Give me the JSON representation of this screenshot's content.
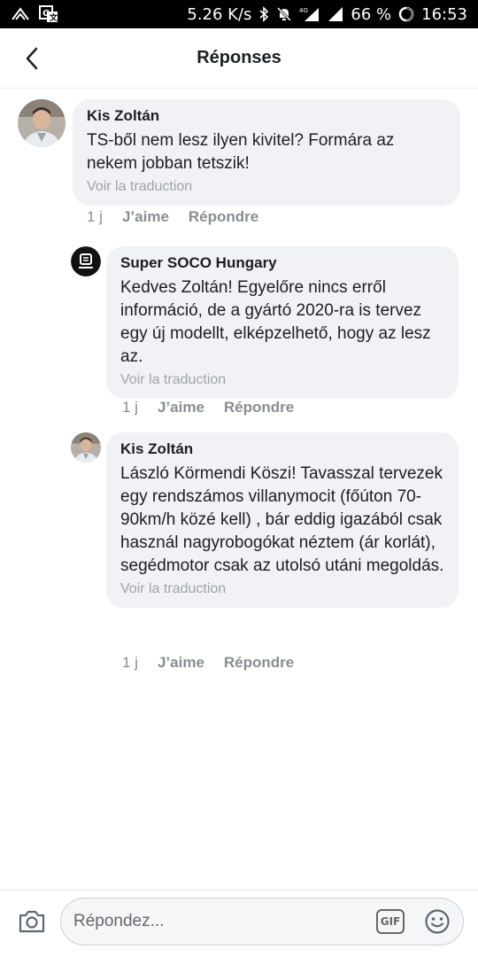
{
  "status_bar": {
    "speed": "5.26 K/s",
    "network": "4G",
    "battery": "66 %",
    "time": "16:53"
  },
  "header": {
    "title": "Réponses"
  },
  "comments": [
    {
      "author": "Kis Zoltán",
      "text": "TS-ből nem lesz ilyen kivitel? Formára az nekem jobban tetszik!",
      "translate": "Voir la traduction",
      "time": "1 j",
      "like": "J’aime",
      "reply": "Répondre"
    },
    {
      "author": "Super SOCO Hungary",
      "text": "Kedves Zoltán! Egyelőre nincs erről információ, de a gyártó 2020-ra is tervez egy új modellt, elképzelhető, hogy az lesz az.",
      "translate": "Voir la traduction",
      "time": "1 j",
      "like": "J’aime",
      "reply": "Répondre"
    },
    {
      "author": "Kis Zoltán",
      "text": "László Körmendi Köszi! Tavasszal tervezek egy rendszámos villanymocit (főúton 70-90km/h közé kell) , bár eddig igazából csak használ nagyrobogókat néztem (ár korlát), segédmotor csak az utolsó utáni megoldás.",
      "translate": "Voir la traduction",
      "time": "1 j",
      "like": "J’aime",
      "reply": "Répondre"
    }
  ],
  "composer": {
    "placeholder": "Répondez...",
    "gif_label": "GIF"
  },
  "colors": {
    "bubble": "#f0f2f5",
    "meta_text": "#8a8d91",
    "translate_text": "#a0a3a8"
  }
}
